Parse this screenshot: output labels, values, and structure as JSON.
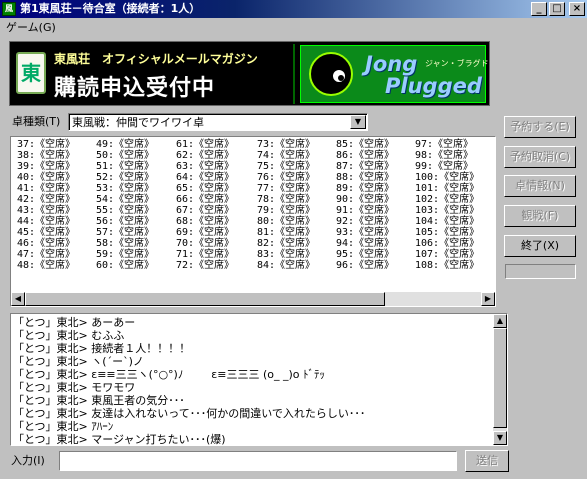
{
  "window": {
    "title": "第1東風荘－待合室（接続者：1人）",
    "app_icon_text": "風",
    "minimize_glyph": "_",
    "maximize_glyph": "□",
    "close_glyph": "×"
  },
  "menu": {
    "items": [
      {
        "label": "ゲーム(G)"
      }
    ]
  },
  "banner": {
    "tile_char": "東",
    "brand": "東風荘　オフィシャルメールマガジン",
    "headline": "購読申込受付中",
    "logo_line1": "Jong",
    "logo_line2": "Plugged",
    "logo_kana": "ジャン・ブラグド"
  },
  "table_type": {
    "label": "卓種類(T)",
    "selected": "東風戦：仲間でワイワイ卓",
    "dropdown_glyph": "▼"
  },
  "side_buttons": [
    {
      "label": "予約する(E)",
      "enabled": false
    },
    {
      "label": "予約取消(C)",
      "enabled": false
    },
    {
      "label": "卓情報(N)",
      "enabled": false
    },
    {
      "label": "観戦(F)",
      "enabled": false
    },
    {
      "label": "終了(X)",
      "enabled": true
    }
  ],
  "table_list": {
    "columns": [
      [
        "37:《空席》",
        "38:《空席》",
        "39:《空席》",
        "40:《空席》",
        "41:《空席》",
        "42:《空席》",
        "43:《空席》",
        "44:《空席》",
        "45:《空席》",
        "46:《空席》",
        "47:《空席》",
        "48:《空席》"
      ],
      [
        "49:《空席》",
        "50:《空席》",
        "51:《空席》",
        "52:《空席》",
        "53:《空席》",
        "54:《空席》",
        "55:《空席》",
        "56:《空席》",
        "57:《空席》",
        "58:《空席》",
        "59:《空席》",
        "60:《空席》"
      ],
      [
        "61:《空席》",
        "62:《空席》",
        "63:《空席》",
        "64:《空席》",
        "65:《空席》",
        "66:《空席》",
        "67:《空席》",
        "68:《空席》",
        "69:《空席》",
        "70:《空席》",
        "71:《空席》",
        "72:《空席》"
      ],
      [
        "73:《空席》",
        "74:《空席》",
        "75:《空席》",
        "76:《空席》",
        "77:《空席》",
        "78:《空席》",
        "79:《空席》",
        "80:《空席》",
        "81:《空席》",
        "82:《空席》",
        "83:《空席》",
        "84:《空席》"
      ],
      [
        "85:《空席》",
        "86:《空席》",
        "87:《空席》",
        "88:《空席》",
        "89:《空席》",
        "90:《空席》",
        "91:《空席》",
        "92:《空席》",
        "93:《空席》",
        "94:《空席》",
        "95:《空席》",
        "96:《空席》"
      ],
      [
        "97:《空席》",
        "98:《空席》",
        "99:《空席》",
        "100:《空席》",
        "101:《空席》",
        "102:《空席》",
        "103:《空席》",
        "104:《空席》",
        "105:《空席》",
        "106:《空席》",
        "107:《空席》",
        "108:《空席》"
      ]
    ],
    "scroll_left_glyph": "◀",
    "scroll_right_glyph": "▶"
  },
  "chat": {
    "lines": [
      "「とつ」東北> あーあー",
      "「とつ」東北> むふふ",
      "「とつ」東北> 接続者１人！！！！",
      "「とつ」東北> ヽ(´ー`)ノ",
      "「とつ」東北> ε≡≡三三ヽ(°○°)ﾉ        ε≡三三三 (o_ _)o ﾄﾞﾃｯ",
      "「とつ」東北> モワモワ",
      "「とつ」東北> 東風王者の気分･･･",
      "「とつ」東北> 友達は入れないって･･･何かの間違いで入れたらしい･･･",
      "「とつ」東北> ｱﾊｰﾝ",
      "「とつ」東北> マージャン打ちたい･･･(爆)"
    ],
    "scroll_up_glyph": "▲",
    "scroll_down_glyph": "▼"
  },
  "input": {
    "label": "入力(I)",
    "value": "",
    "send_label": "送信"
  }
}
